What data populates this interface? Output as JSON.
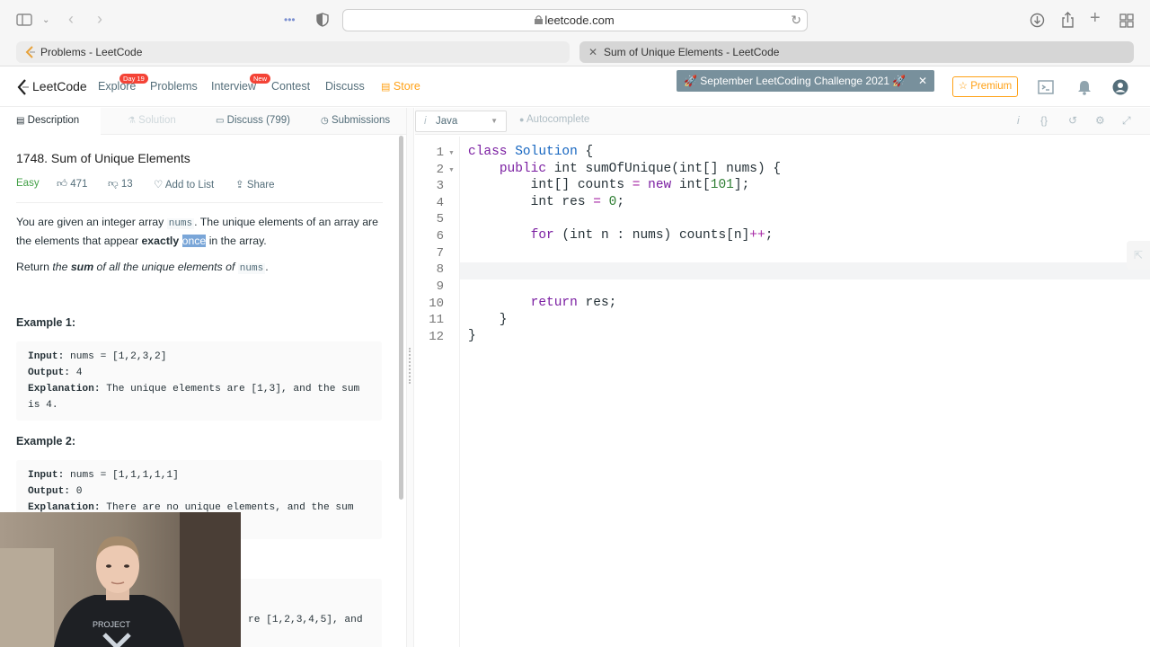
{
  "browser": {
    "url": "leetcode.com",
    "tabs": [
      {
        "title": "Problems - LeetCode"
      },
      {
        "title": "Sum of Unique Elements - LeetCode"
      }
    ]
  },
  "nav": {
    "logo": "LeetCode",
    "items": [
      {
        "label": "Explore",
        "badge": "Day 19"
      },
      {
        "label": "Problems"
      },
      {
        "label": "Interview",
        "badge": "New"
      },
      {
        "label": "Contest"
      },
      {
        "label": "Discuss"
      },
      {
        "label": "Store"
      }
    ],
    "banner": "🚀 September LeetCoding Challenge 2021 🚀",
    "premium": "☆ Premium"
  },
  "left_tabs": [
    "Description",
    "Solution",
    "Discuss (799)",
    "Submissions"
  ],
  "problem": {
    "title": "1748. Sum of Unique Elements",
    "difficulty": "Easy",
    "likes": "471",
    "dislikes": "13",
    "add_to_list": "Add to List",
    "share": "Share",
    "p1_a": "You are given an integer array ",
    "p1_code": "nums",
    "p1_b": ". The unique elements of an array are the elements that appear ",
    "p1_bold": "exactly",
    "p1_sp": " ",
    "p1_hl": "once",
    "p1_c": " in the array.",
    "p2_a": "Return ",
    "p2_i1": "the ",
    "p2_bold": "sum",
    "p2_i2": " of all the unique elements of ",
    "p2_code": "nums",
    "p2_end": ".",
    "examples": [
      {
        "heading": "Example 1:",
        "input_label": "Input:",
        "input": " nums = [1,2,3,2]",
        "output_label": "Output:",
        "output": " 4",
        "expl_label": "Explanation:",
        "expl": " The unique elements are [1,3], and the sum is 4."
      },
      {
        "heading": "Example 2:",
        "input_label": "Input:",
        "input": " nums = [1,1,1,1,1]",
        "output_label": "Output:",
        "output": " 0",
        "expl_label": "Explanation:",
        "expl": " There are no unique elements, and the sum"
      }
    ],
    "partial_tail": "re [1,2,3,4,5], and"
  },
  "editor": {
    "language": "Java",
    "autocomplete": "Autocomplete",
    "line_numbers": [
      "1",
      "2",
      "3",
      "4",
      "5",
      "6",
      "7",
      "8",
      "9",
      "10",
      "11",
      "12"
    ],
    "code": {
      "l1a": "class ",
      "l1b": "Solution",
      "l1c": " {",
      "l2a": "    ",
      "l2b": "public",
      "l2c": " int sumOfUnique(int[] nums) {",
      "l3a": "        int[] counts ",
      "l3b": "=",
      "l3c": " ",
      "l3d": "new",
      "l3e": " int[",
      "l3f": "101",
      "l3g": "];",
      "l4a": "        int res ",
      "l4b": "=",
      "l4c": " ",
      "l4d": "0",
      "l4e": ";",
      "l6a": "        ",
      "l6b": "for",
      "l6c": " (int n : nums) counts[n]",
      "l6d": "++",
      "l6e": ";",
      "l10a": "        ",
      "l10b": "return",
      "l10c": " res;",
      "l11": "    }",
      "l12": "}"
    }
  }
}
